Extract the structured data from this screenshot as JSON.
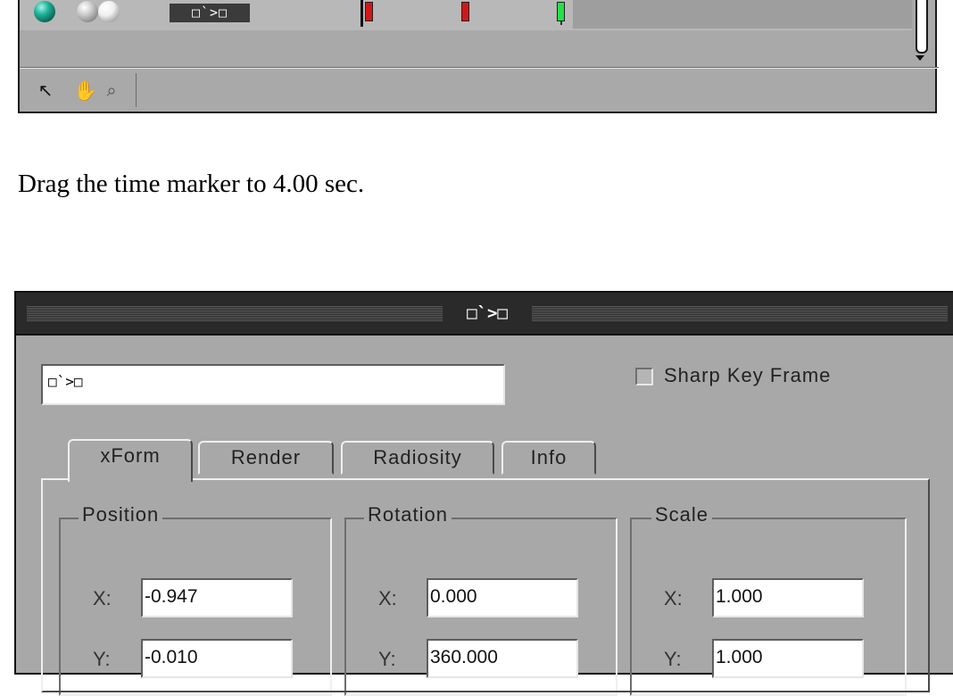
{
  "timeline": {
    "object_label": "□`>□"
  },
  "instruction": "Drag the time marker to 4.00 sec.",
  "dialog": {
    "title": "□`>□",
    "name_value": "□`>□",
    "sharp_key_frame_label": "Sharp Key Frame",
    "sharp_key_frame_checked": false,
    "tabs": [
      {
        "label": "xForm",
        "active": true
      },
      {
        "label": "Render",
        "active": false
      },
      {
        "label": "Radiosity",
        "active": false
      },
      {
        "label": "Info",
        "active": false
      }
    ],
    "groups": {
      "position": {
        "title": "Position",
        "x_label": "X:",
        "x": "-0.947",
        "y_label": "Y:",
        "y": "-0.010"
      },
      "rotation": {
        "title": "Rotation",
        "x_label": "X:",
        "x": "0.000",
        "y_label": "Y:",
        "y": "360.000"
      },
      "scale": {
        "title": "Scale",
        "x_label": "X:",
        "x": "1.000",
        "y_label": "Y:",
        "y": "1.000"
      }
    }
  },
  "colors": {
    "panel_gray": "#a8a8a8",
    "title_bar": "#2a2a2a",
    "key_red": "#d0181a",
    "key_green": "#26e04a"
  }
}
